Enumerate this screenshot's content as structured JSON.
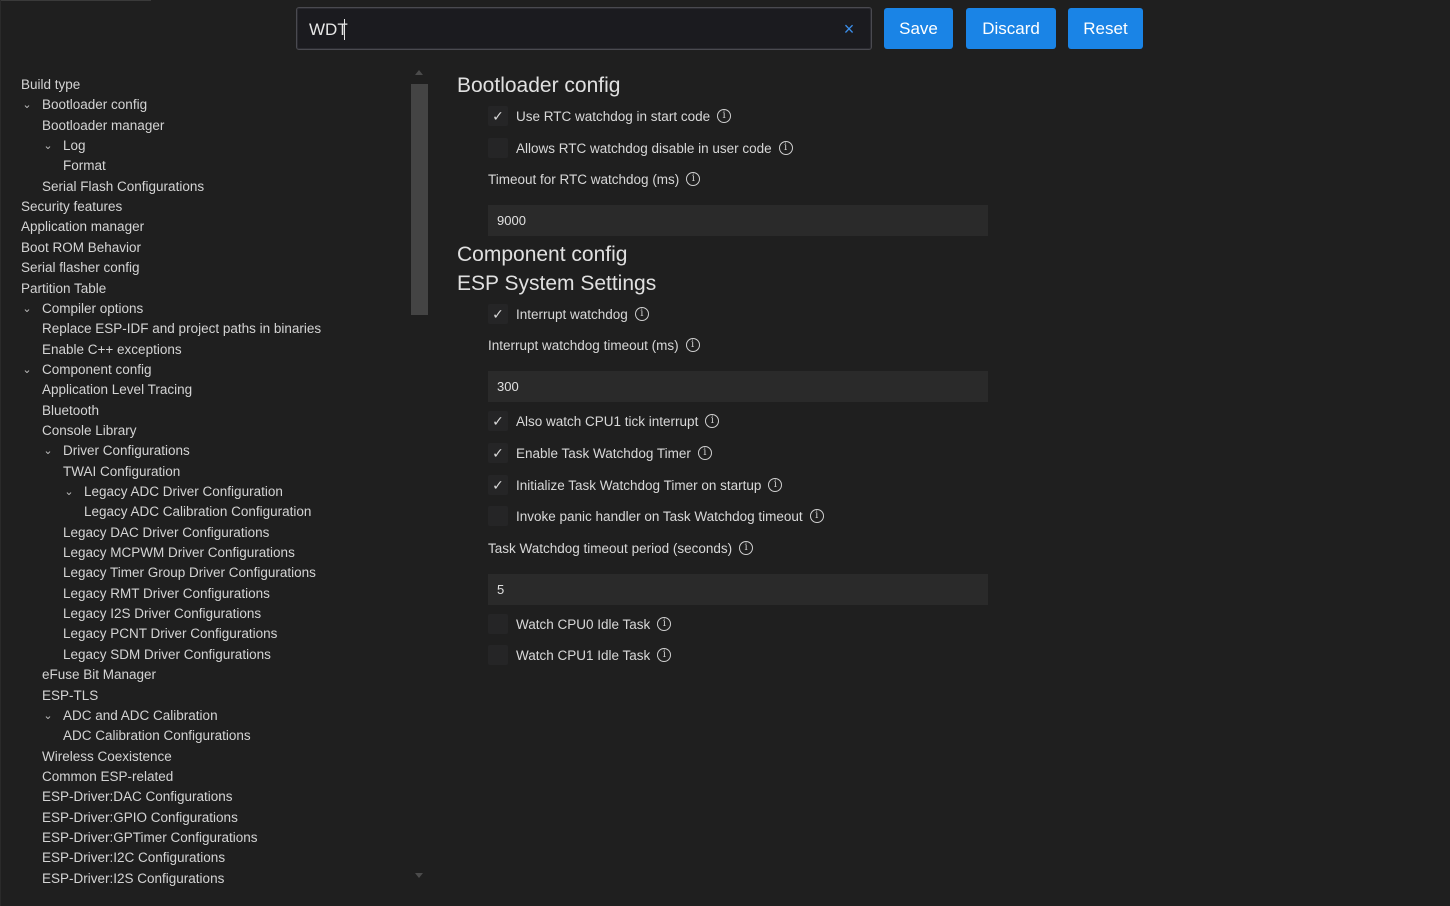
{
  "search": {
    "value": "WDT",
    "clear_icon": "×"
  },
  "toolbar": {
    "save_label": "Save",
    "discard_label": "Discard",
    "reset_label": "Reset"
  },
  "tree": {
    "items": [
      {
        "label": "Build type",
        "chevron": ""
      },
      {
        "label": "Bootloader config",
        "chevron": "⌄"
      },
      {
        "label": "Bootloader manager",
        "chevron": ""
      },
      {
        "label": "Log",
        "chevron": "⌄"
      },
      {
        "label": "Format",
        "chevron": ""
      },
      {
        "label": "Serial Flash Configurations",
        "chevron": ""
      },
      {
        "label": "Security features",
        "chevron": ""
      },
      {
        "label": "Application manager",
        "chevron": ""
      },
      {
        "label": "Boot ROM Behavior",
        "chevron": ""
      },
      {
        "label": "Serial flasher config",
        "chevron": ""
      },
      {
        "label": "Partition Table",
        "chevron": ""
      },
      {
        "label": "Compiler options",
        "chevron": "⌄"
      },
      {
        "label": "Replace ESP-IDF and project paths in binaries",
        "chevron": ""
      },
      {
        "label": "Enable C++ exceptions",
        "chevron": ""
      },
      {
        "label": "Component config",
        "chevron": "⌄"
      },
      {
        "label": "Application Level Tracing",
        "chevron": ""
      },
      {
        "label": "Bluetooth",
        "chevron": ""
      },
      {
        "label": "Console Library",
        "chevron": ""
      },
      {
        "label": "Driver Configurations",
        "chevron": "⌄"
      },
      {
        "label": "TWAI Configuration",
        "chevron": ""
      },
      {
        "label": "Legacy ADC Driver Configuration",
        "chevron": "⌄"
      },
      {
        "label": "Legacy ADC Calibration Configuration",
        "chevron": ""
      },
      {
        "label": "Legacy DAC Driver Configurations",
        "chevron": ""
      },
      {
        "label": "Legacy MCPWM Driver Configurations",
        "chevron": ""
      },
      {
        "label": "Legacy Timer Group Driver Configurations",
        "chevron": ""
      },
      {
        "label": "Legacy RMT Driver Configurations",
        "chevron": ""
      },
      {
        "label": "Legacy I2S Driver Configurations",
        "chevron": ""
      },
      {
        "label": "Legacy PCNT Driver Configurations",
        "chevron": ""
      },
      {
        "label": "Legacy SDM Driver Configurations",
        "chevron": ""
      },
      {
        "label": "eFuse Bit Manager",
        "chevron": ""
      },
      {
        "label": "ESP-TLS",
        "chevron": ""
      },
      {
        "label": "ADC and ADC Calibration",
        "chevron": "⌄"
      },
      {
        "label": "ADC Calibration Configurations",
        "chevron": ""
      },
      {
        "label": "Wireless Coexistence",
        "chevron": ""
      },
      {
        "label": "Common ESP-related",
        "chevron": ""
      },
      {
        "label": "ESP-Driver:DAC Configurations",
        "chevron": ""
      },
      {
        "label": "ESP-Driver:GPIO Configurations",
        "chevron": ""
      },
      {
        "label": "ESP-Driver:GPTimer Configurations",
        "chevron": ""
      },
      {
        "label": "ESP-Driver:I2C Configurations",
        "chevron": ""
      },
      {
        "label": "ESP-Driver:I2S Configurations",
        "chevron": ""
      }
    ]
  },
  "main": {
    "bootloader_title": "Bootloader config",
    "use_rtc_wdt": {
      "label": "Use RTC watchdog in start code",
      "checked": true,
      "mark": "✓"
    },
    "allow_rtc_wdt_disable": {
      "label": "Allows RTC watchdog disable in user code",
      "checked": false,
      "mark": ""
    },
    "rtc_wdt_timeout_label": "Timeout for RTC watchdog (ms)",
    "rtc_wdt_timeout_value": "9000",
    "component_title": "Component config",
    "esp_system_title": "ESP System Settings",
    "interrupt_wdt": {
      "label": "Interrupt watchdog",
      "checked": true,
      "mark": "✓"
    },
    "int_wdt_timeout_label": "Interrupt watchdog timeout (ms)",
    "int_wdt_timeout_value": "300",
    "watch_cpu1_tick": {
      "label": "Also watch CPU1 tick interrupt",
      "checked": true,
      "mark": "✓"
    },
    "enable_task_wdt": {
      "label": "Enable Task Watchdog Timer",
      "checked": true,
      "mark": "✓"
    },
    "init_task_wdt": {
      "label": "Initialize Task Watchdog Timer on startup",
      "checked": true,
      "mark": "✓"
    },
    "task_wdt_panic": {
      "label": "Invoke panic handler on Task Watchdog timeout",
      "checked": false,
      "mark": ""
    },
    "task_wdt_period_label": "Task Watchdog timeout period (seconds)",
    "task_wdt_period_value": "5",
    "watch_cpu0_idle": {
      "label": "Watch CPU0 Idle Task",
      "checked": false,
      "mark": ""
    },
    "watch_cpu1_idle": {
      "label": "Watch CPU1 Idle Task",
      "checked": false,
      "mark": ""
    }
  },
  "icons": {
    "info": "i"
  },
  "colors": {
    "accent": "#1a84e6",
    "background": "#1f1f1f",
    "clear_icon": "#3b8eea"
  }
}
